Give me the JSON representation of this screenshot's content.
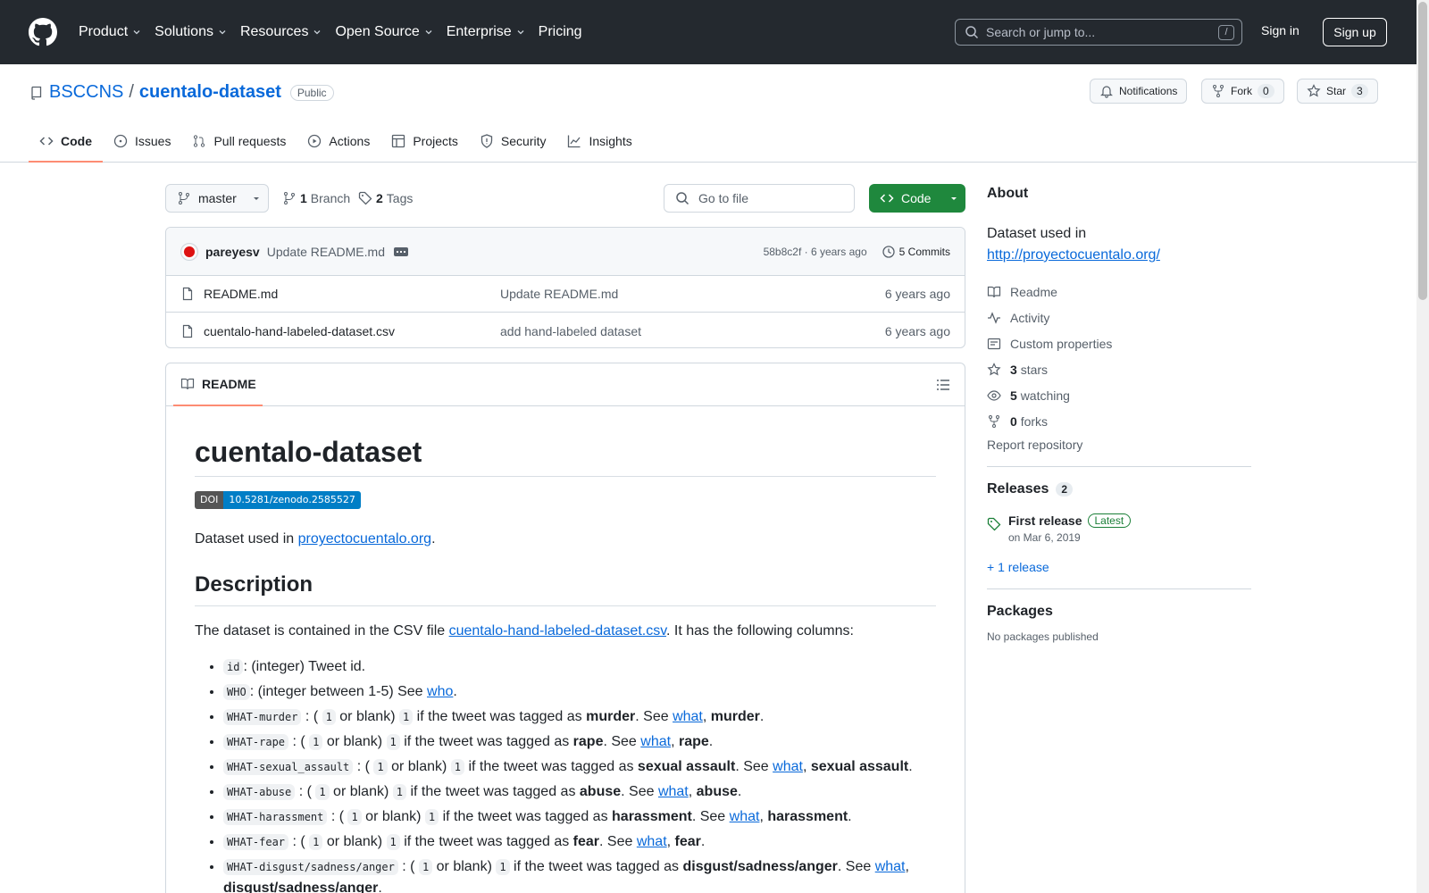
{
  "header": {
    "nav": [
      "Product",
      "Solutions",
      "Resources",
      "Open Source",
      "Enterprise",
      "Pricing"
    ],
    "search_placeholder": "Search or jump to...",
    "search_kbd": "/",
    "sign_in": "Sign in",
    "sign_up": "Sign up"
  },
  "repo": {
    "owner": "BSCCNS",
    "name": "cuentalo-dataset",
    "visibility": "Public",
    "notifications": "Notifications",
    "fork_label": "Fork",
    "fork_count": "0",
    "star_label": "Star",
    "star_count": "3",
    "tabs": [
      "Code",
      "Issues",
      "Pull requests",
      "Actions",
      "Projects",
      "Security",
      "Insights"
    ]
  },
  "toolbar": {
    "branch": "master",
    "branch_count": "1",
    "branch_label": "Branch",
    "tag_count": "2",
    "tag_label": "Tags",
    "goto_placeholder": "Go to file",
    "code_label": "Code"
  },
  "commit": {
    "author": "pareyesv",
    "message": "Update README.md",
    "hash_time": "58b8c2f · 6 years ago",
    "commits": "5 Commits"
  },
  "files": [
    {
      "name": "README.md",
      "message": "Update README.md",
      "age": "6 years ago"
    },
    {
      "name": "cuentalo-hand-labeled-dataset.csv",
      "message": "add hand-labeled dataset",
      "age": "6 years ago"
    }
  ],
  "readme": {
    "tab": "README",
    "title": "cuentalo-dataset",
    "doi_label": "DOI",
    "doi_value": "10.5281/zenodo.2585527",
    "intro_text": "Dataset used in ",
    "intro_link": "proyectocuentalo.org",
    "intro_end": ".",
    "desc_heading": "Description",
    "desc_text": "The dataset is contained in the CSV file ",
    "desc_link": "cuentalo-hand-labeled-dataset.csv",
    "desc_end": ". It has the following columns:",
    "see": "See",
    "what": "what",
    "who": "who",
    "one": "1",
    "or_blank": "or blank)",
    "tagged": "if the tweet was tagged as",
    "columns": [
      {
        "code": "id",
        "text": ": (integer) Tweet id."
      },
      {
        "code": "WHO",
        "text": ": (integer between 1-5) See"
      },
      {
        "code": "WHAT-murder",
        "term": "murder"
      },
      {
        "code": "WHAT-rape",
        "term": "rape"
      },
      {
        "code": "WHAT-sexual_assault",
        "term": "sexual assault"
      },
      {
        "code": "WHAT-abuse",
        "term": "abuse"
      },
      {
        "code": "WHAT-harassment",
        "term": "harassment"
      },
      {
        "code": "WHAT-fear",
        "term": "fear"
      },
      {
        "code": "WHAT-disgust/sadness/anger",
        "term": "disgust/sadness/anger"
      }
    ]
  },
  "sidebar": {
    "about_heading": "About",
    "about_desc": "Dataset used in",
    "about_link": "http://proyectocuentalo.org/",
    "items": [
      {
        "icon": "book-icon",
        "label": "Readme",
        "count": ""
      },
      {
        "icon": "pulse-icon",
        "label": "Activity",
        "count": ""
      },
      {
        "icon": "note-icon",
        "label": "Custom properties",
        "count": ""
      },
      {
        "icon": "star-icon",
        "label": "stars",
        "count": "3"
      },
      {
        "icon": "eye-icon",
        "label": "watching",
        "count": "5"
      },
      {
        "icon": "fork-icon",
        "label": "forks",
        "count": "0"
      }
    ],
    "report": "Report repository",
    "releases_heading": "Releases",
    "releases_count": "2",
    "release_title": "First release",
    "release_badge": "Latest",
    "release_date": "on Mar 6, 2019",
    "more_releases": "+ 1 release",
    "packages_heading": "Packages",
    "packages_text": "No packages published"
  }
}
